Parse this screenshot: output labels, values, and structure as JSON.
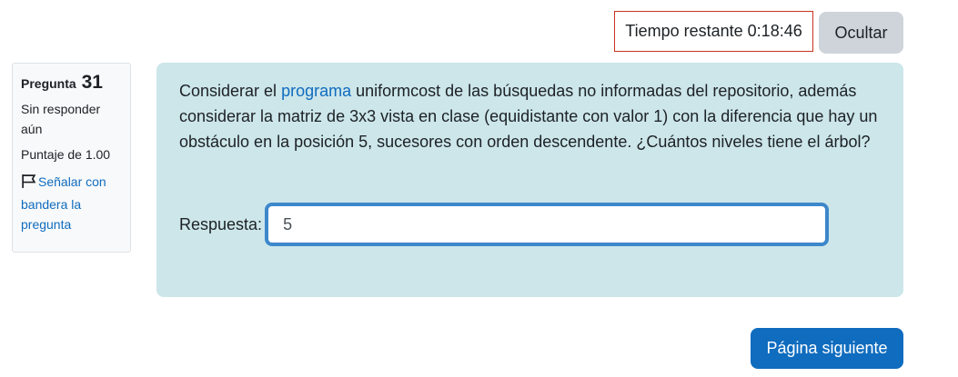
{
  "timer": {
    "label": "Tiempo restante",
    "value": "0:18:46",
    "border_color": "#ca3120"
  },
  "hide_button": {
    "label": "Ocultar"
  },
  "question_info": {
    "label": "Pregunta",
    "number": "31",
    "status": "Sin responder aún",
    "grade": "Puntaje de 1.00",
    "flag_link": "Señalar con bandera la pregunta",
    "flag_icon": "flag-outline-icon"
  },
  "question": {
    "text_before_link": "Considerar el ",
    "link_text": "programa",
    "text_after_link": " uniformcost de las búsquedas no informadas del repositorio, además considerar la matriz de 3x3 vista en clase (equidistante con valor 1) con la diferencia que hay un obstáculo en la posición 5, sucesores con orden descendente. ¿Cuántos niveles tiene el árbol?",
    "answer_label": "Respuesta:",
    "answer_value": "5",
    "background_color": "#cce6ea"
  },
  "next_button": {
    "label": "Página siguiente",
    "color": "#0f6cbf"
  }
}
